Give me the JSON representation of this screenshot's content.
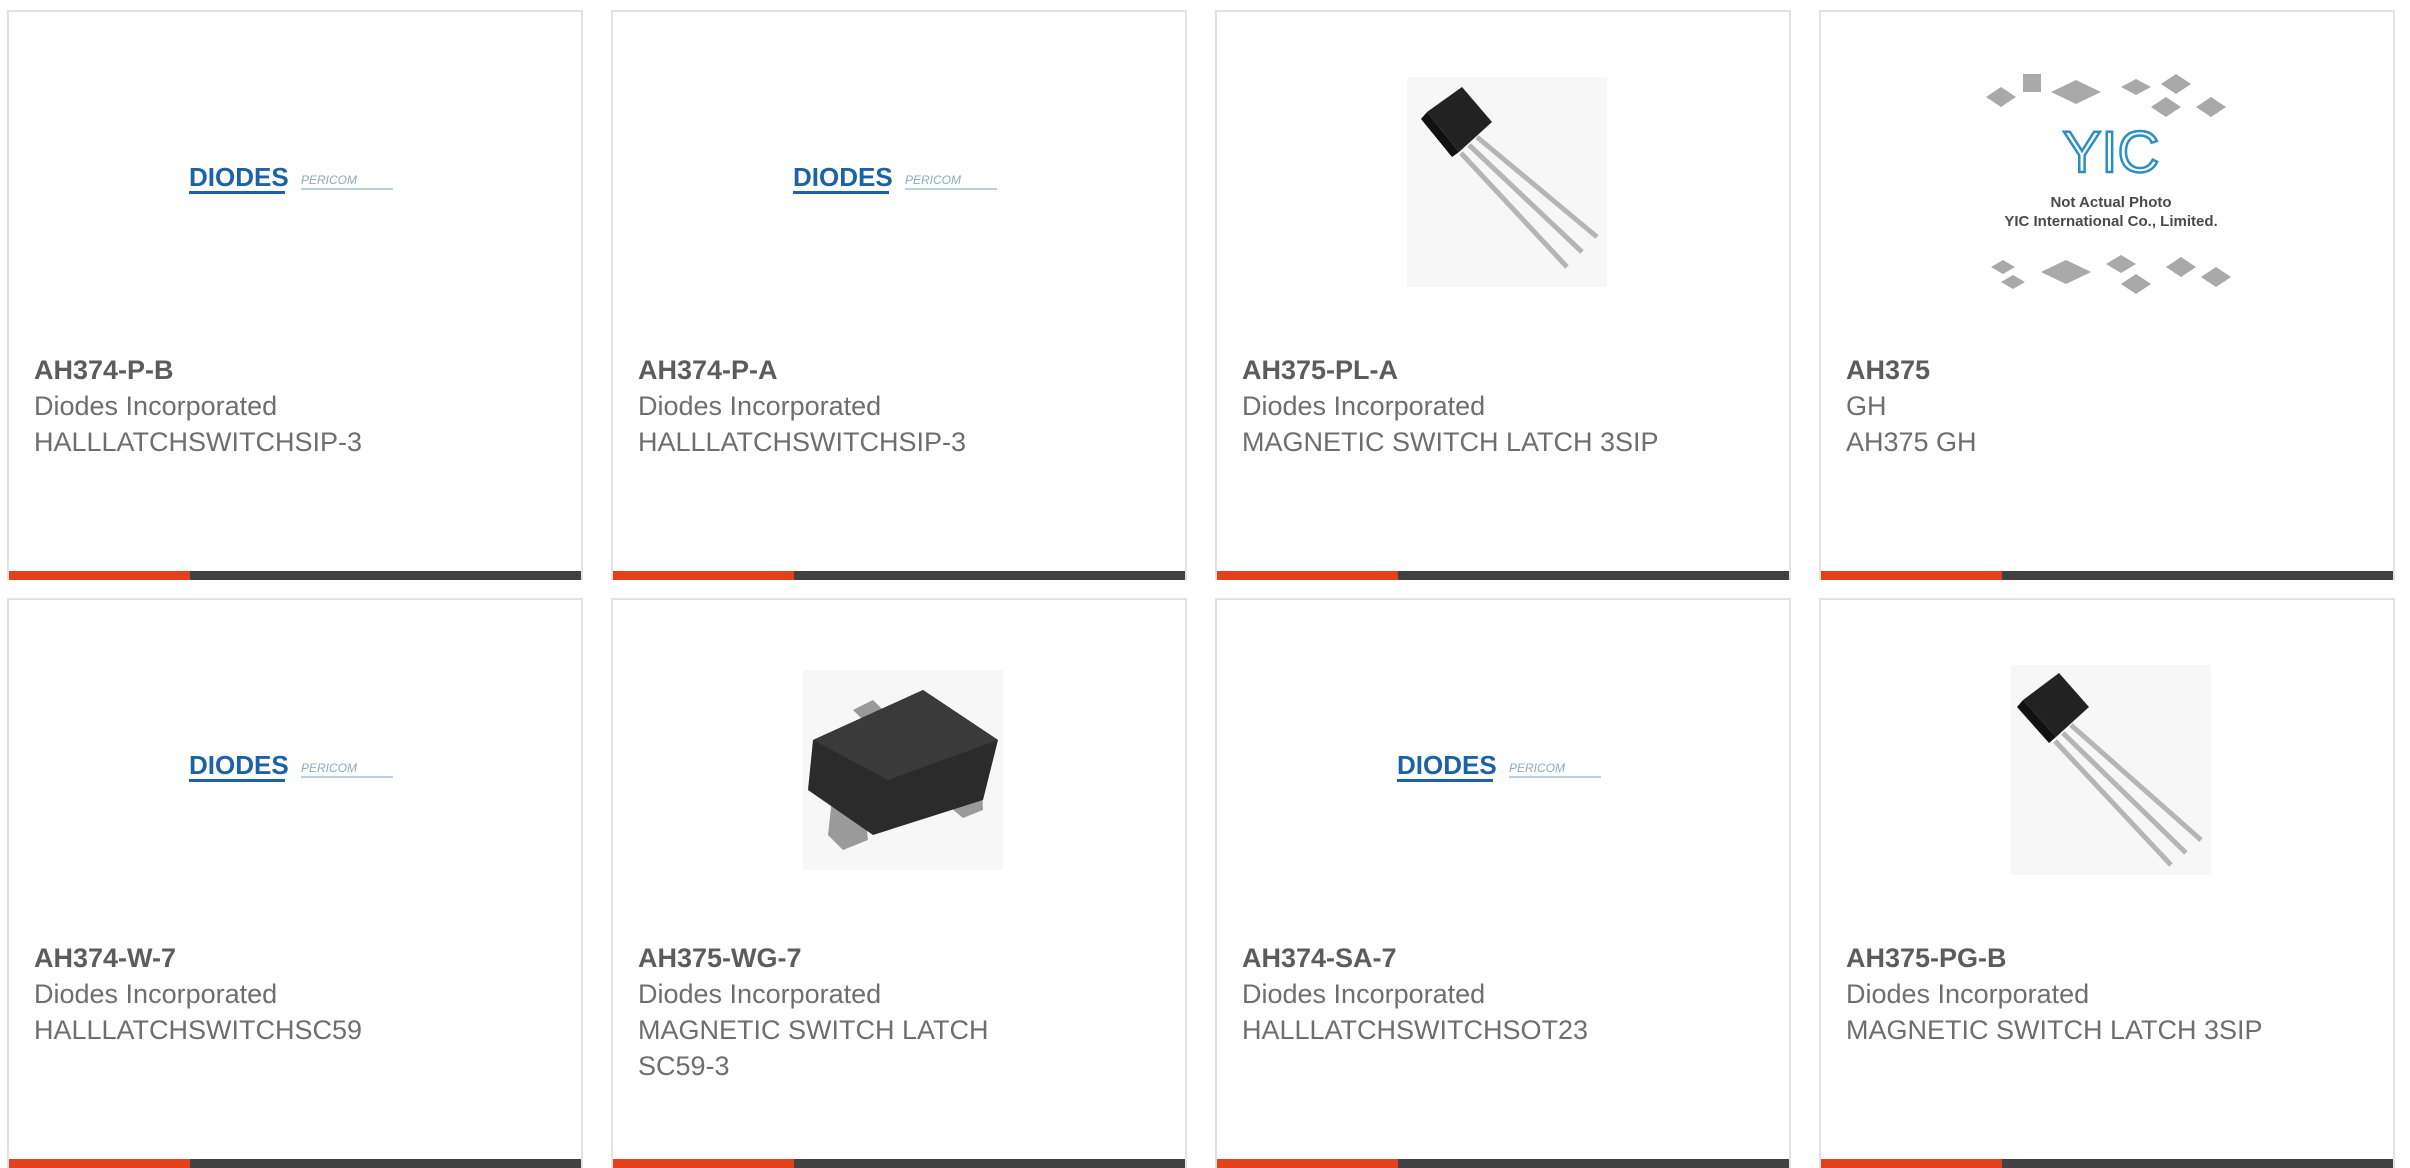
{
  "colors": {
    "accent": "#e4401b",
    "bar": "#414141",
    "border": "#e2e2e2",
    "logo_blue": "#1b62a8"
  },
  "logo": {
    "primary": "DIODES",
    "secondary": "PERICOM"
  },
  "yic": {
    "brand": "YIC",
    "line1": "Not Actual Photo",
    "line2": "YIC International Co., Limited."
  },
  "products": [
    {
      "part": "AH374-P-B",
      "manufacturer": "Diodes Incorporated",
      "description": "HALLLATCHSWITCHSIP-3",
      "image": "diodes-logo"
    },
    {
      "part": "AH374-P-A",
      "manufacturer": "Diodes Incorporated",
      "description": "HALLLATCHSWITCHSIP-3",
      "image": "diodes-logo"
    },
    {
      "part": "AH375-PL-A",
      "manufacturer": "Diodes Incorporated",
      "description": "MAGNETIC SWITCH LATCH 3SIP",
      "image": "sip3-package"
    },
    {
      "part": "AH375",
      "manufacturer": "GH",
      "description": "AH375 GH",
      "image": "yic-placeholder"
    },
    {
      "part": "AH374-W-7",
      "manufacturer": "Diodes Incorporated",
      "description": "HALLLATCHSWITCHSC59",
      "image": "diodes-logo"
    },
    {
      "part": "AH375-WG-7",
      "manufacturer": "Diodes Incorporated",
      "description": "MAGNETIC SWITCH LATCH SC59-3",
      "image": "sc59-package"
    },
    {
      "part": "AH374-SA-7",
      "manufacturer": "Diodes Incorporated",
      "description": "HALLLATCHSWITCHSOT23",
      "image": "diodes-logo"
    },
    {
      "part": "AH375-PG-B",
      "manufacturer": "Diodes Incorporated",
      "description": "MAGNETIC SWITCH LATCH 3SIP",
      "image": "sip3-package"
    }
  ]
}
